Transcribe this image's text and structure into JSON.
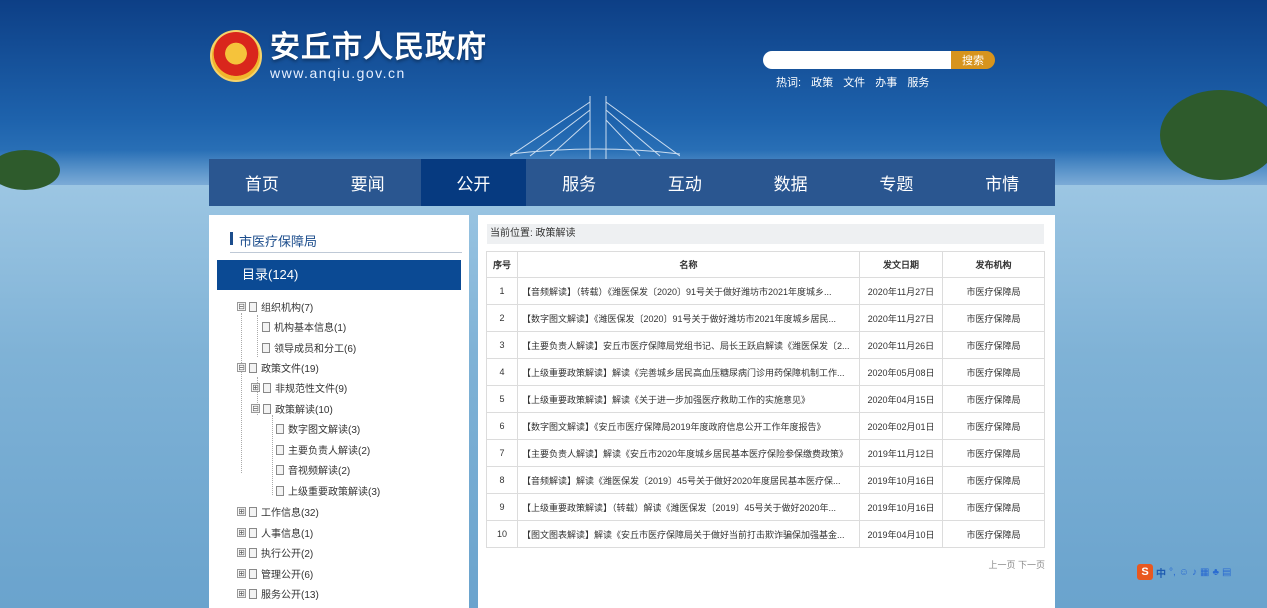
{
  "header": {
    "site_name": "安丘市人民政府",
    "site_url": "www.anqiu.gov.cn"
  },
  "search": {
    "placeholder": "",
    "button": "搜索",
    "hot_label": "热词:",
    "hot_words": [
      "政策",
      "文件",
      "办事",
      "服务"
    ]
  },
  "nav": {
    "items": [
      "首页",
      "要闻",
      "公开",
      "服务",
      "互动",
      "数据",
      "专题",
      "市情"
    ],
    "active": "公开"
  },
  "sidebar": {
    "title": "市医疗保障局",
    "directory": "目录(124)",
    "tree": [
      {
        "label": "组织机构(7)",
        "toggle": "⊟"
      },
      {
        "label": "机构基本信息(1)"
      },
      {
        "label": "领导成员和分工(6)"
      },
      {
        "label": "政策文件(19)",
        "toggle": "⊟"
      },
      {
        "label": "非规范性文件(9)",
        "toggle": "⊞"
      },
      {
        "label": "政策解读(10)",
        "toggle": "⊟"
      },
      {
        "label": "数字图文解读(3)"
      },
      {
        "label": "主要负责人解读(2)"
      },
      {
        "label": "音视频解读(2)"
      },
      {
        "label": "上级重要政策解读(3)"
      },
      {
        "label": "工作信息(32)",
        "toggle": "⊞"
      },
      {
        "label": "人事信息(1)",
        "toggle": "⊞"
      },
      {
        "label": "执行公开(2)",
        "toggle": "⊞"
      },
      {
        "label": "管理公开(6)",
        "toggle": "⊞"
      },
      {
        "label": "服务公开(13)",
        "toggle": "⊞"
      }
    ]
  },
  "main": {
    "breadcrumb": "当前位置:  政策解读",
    "columns": [
      "序号",
      "名称",
      "发文日期",
      "发布机构"
    ],
    "rows": [
      [
        "1",
        "【音频解读】（转载）《潍医保发〔2020〕91号关于做好潍坊市2021年度城乡...",
        "2020年11月27日",
        "市医疗保障局"
      ],
      [
        "2",
        "【数字图文解读】《潍医保发〔2020〕91号关于做好潍坊市2021年度城乡居民...",
        "2020年11月27日",
        "市医疗保障局"
      ],
      [
        "3",
        "【主要负责人解读】安丘市医疗保障局党组书记、局长王跃启解读《潍医保发〔2...",
        "2020年11月26日",
        "市医疗保障局"
      ],
      [
        "4",
        "【上级重要政策解读】解读《完善城乡居民高血压糖尿病门诊用药保障机制工作...",
        "2020年05月08日",
        "市医疗保障局"
      ],
      [
        "5",
        "【上级重要政策解读】解读《关于进一步加强医疗救助工作的实施意见》",
        "2020年04月15日",
        "市医疗保障局"
      ],
      [
        "6",
        "【数字图文解读】《安丘市医疗保障局2019年度政府信息公开工作年度报告》",
        "2020年02月01日",
        "市医疗保障局"
      ],
      [
        "7",
        "【主要负责人解读】解读《安丘市2020年度城乡居民基本医疗保险参保缴费政策》",
        "2019年11月12日",
        "市医疗保障局"
      ],
      [
        "8",
        "【音频解读】解读《潍医保发〔2019〕45号关于做好2020年度居民基本医疗保...",
        "2019年10月16日",
        "市医疗保障局"
      ],
      [
        "9",
        "【上级重要政策解读】（转载）解读《潍医保发〔2019〕45号关于做好2020年...",
        "2019年10月16日",
        "市医疗保障局"
      ],
      [
        "10",
        "【图文图表解读】解读《安丘市医疗保障局关于做好当前打击欺诈骗保加强基金...",
        "2019年04月10日",
        "市医疗保障局"
      ]
    ],
    "pager": "上一页 下一页"
  },
  "ime": {
    "badge": "S",
    "label": "中"
  }
}
